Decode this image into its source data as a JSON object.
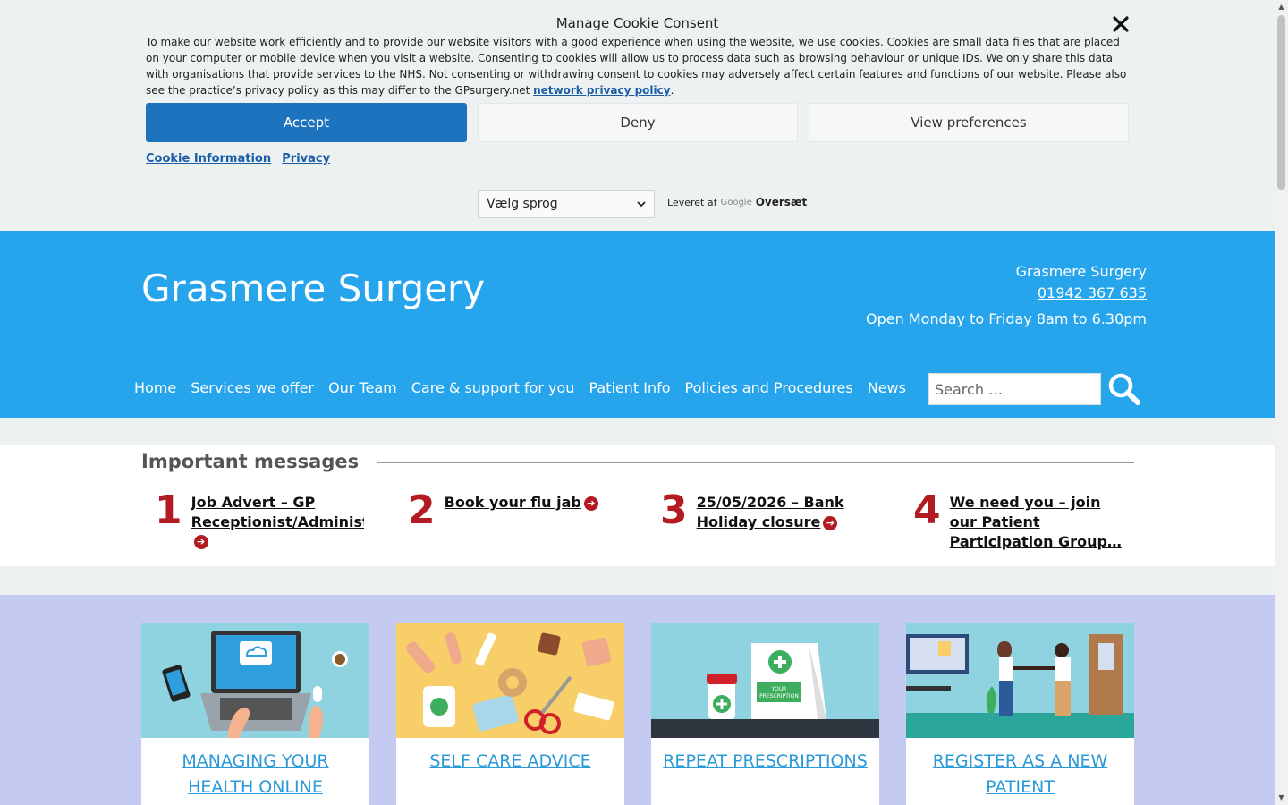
{
  "cookie": {
    "title": "Manage Cookie Consent",
    "text": "To make our website work efficiently and to provide our website visitors with a good experience when using the website, we use cookies. Cookies are small data files that are placed on your computer or mobile device when you visit a website. Consenting to cookies will allow us to process data such as browsing behaviour or unique IDs. We only share this data with organisations that provide services to the NHS. Not consenting or withdrawing consent to cookies may adversely affect certain features and functions of our website. Please also see the practice’s privacy policy as this may differ to the GPsurgery.net",
    "policy_link": "network privacy policy",
    "accept": "Accept",
    "deny": "Deny",
    "prefs": "View preferences",
    "link_info": "Cookie Information",
    "link_privacy": "Privacy",
    "accent_color": "#1e73be"
  },
  "translate": {
    "select_label": "Vælg sprog",
    "powered_by": "Leveret af",
    "google": "Google",
    "translate": "Oversæt"
  },
  "header": {
    "site_title": "Grasmere Surgery",
    "contact_name": "Grasmere Surgery",
    "phone": "01942 367 635",
    "hours": "Open Monday to Friday 8am to 6.30pm",
    "bg_color": "#26a5ec"
  },
  "nav": {
    "items": [
      "Home",
      "Services we offer",
      "Our Team",
      "Care & support for you",
      "Patient Info",
      "Policies and Procedures",
      "News"
    ],
    "search_placeholder": "Search …"
  },
  "messages": {
    "heading": "Important messages",
    "items": [
      {
        "num": "1",
        "text": "Job Advert – GP Receptionist/Administ"
      },
      {
        "num": "2",
        "text": "Book your flu jab"
      },
      {
        "num": "3",
        "text": "25/05/2026 – Bank Holiday closure"
      },
      {
        "num": "4",
        "text": "We need you – join our Patient Participation Group…"
      }
    ],
    "accent_color": "#b31b22"
  },
  "cards": [
    {
      "label": "MANAGING YOUR HEALTH ONLINE",
      "icon": "laptop-illustration"
    },
    {
      "label": "SELF CARE ADVICE",
      "icon": "medicine-illustration"
    },
    {
      "label": "REPEAT PRESCRIPTIONS",
      "icon": "prescription-illustration"
    },
    {
      "label": "REGISTER AS A NEW PATIENT",
      "icon": "handshake-illustration"
    }
  ],
  "prescription_bag_text": "YOUR PRESCRIPTION"
}
